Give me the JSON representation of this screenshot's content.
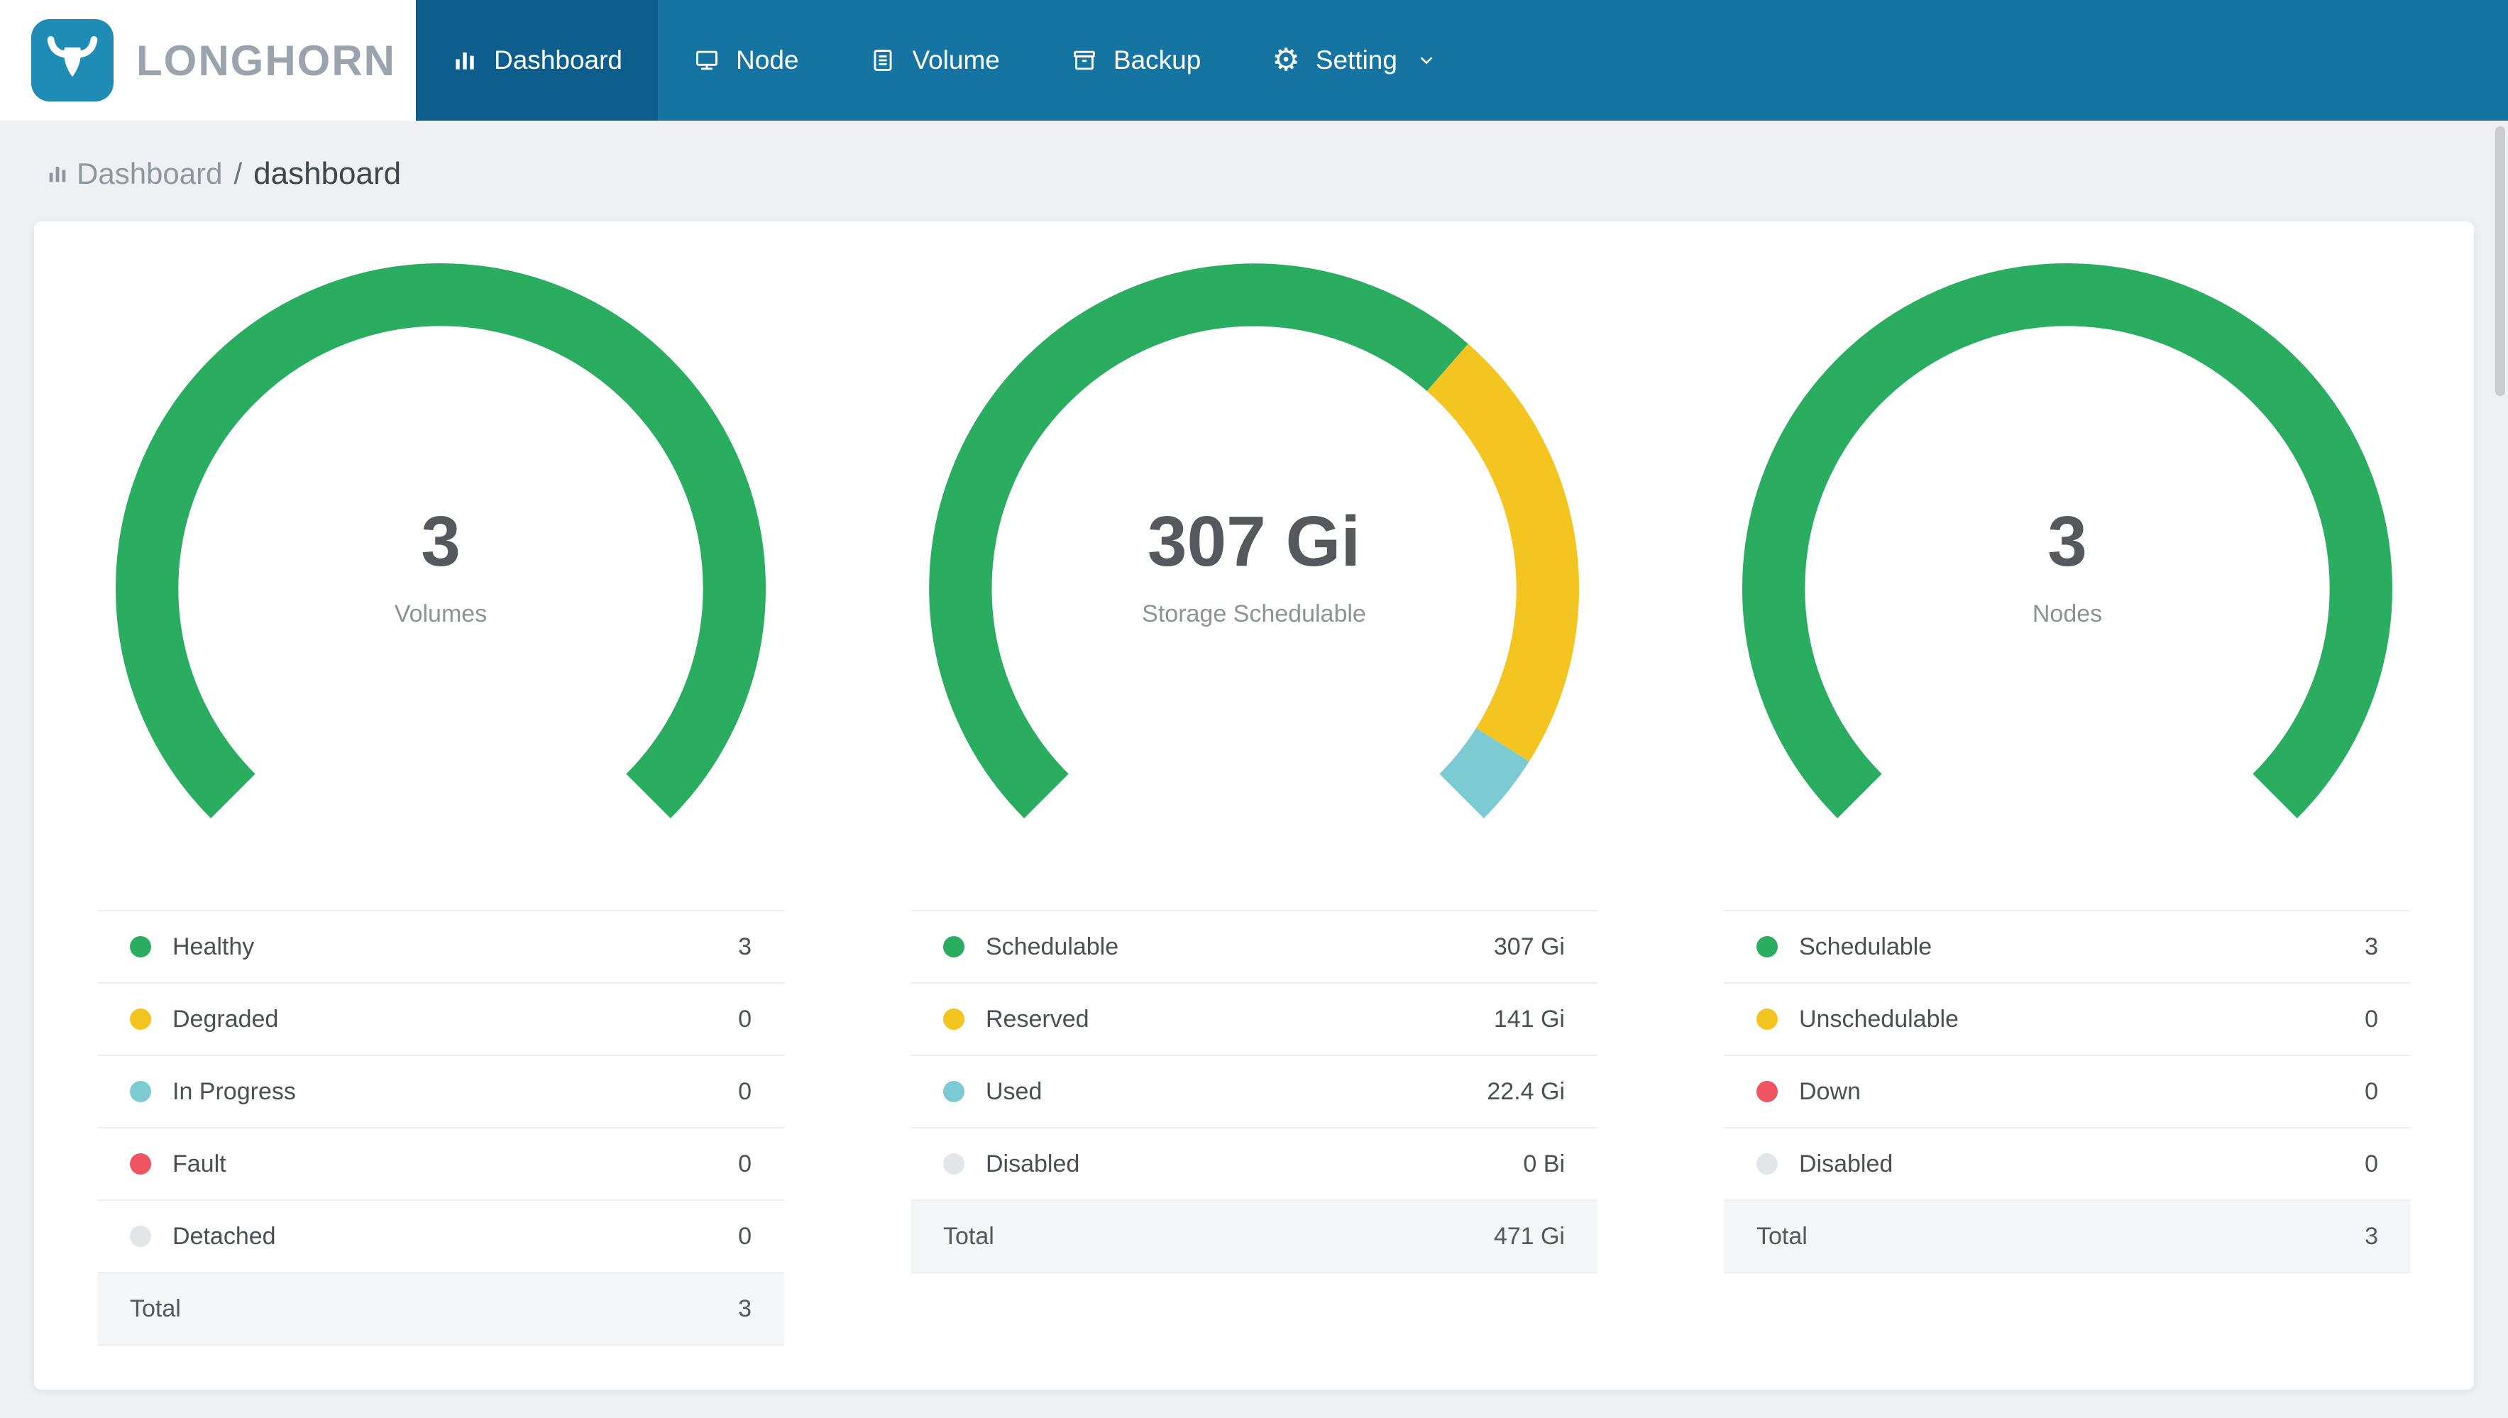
{
  "brand": {
    "name": "LONGHORN",
    "logo_color": "#1E8CB4"
  },
  "navbar": {
    "background": "#1674A2",
    "active_background": "#0D5E8C",
    "items": [
      {
        "label": "Dashboard",
        "icon": "dashboard-icon",
        "active": true
      },
      {
        "label": "Node",
        "icon": "node-icon",
        "active": false
      },
      {
        "label": "Volume",
        "icon": "volume-icon",
        "active": false
      },
      {
        "label": "Backup",
        "icon": "backup-icon",
        "active": false
      },
      {
        "label": "Setting",
        "icon": "setting-icon",
        "active": false,
        "has_dropdown": true
      }
    ]
  },
  "breadcrumb": {
    "section": "Dashboard",
    "separator": "/",
    "page": "dashboard"
  },
  "palette": {
    "green": "#2BAD61",
    "yellow": "#F4C420",
    "teal": "#7CCBD3",
    "red": "#EF5461",
    "gray": "#E3E6E9"
  },
  "chart_data": [
    {
      "type": "gauge",
      "center_value": "3",
      "center_label": "Volumes",
      "sweep_degrees": 270,
      "start_angle": 135,
      "segments": [
        {
          "label": "Healthy",
          "value": 3,
          "display": "3",
          "color": "green"
        },
        {
          "label": "Degraded",
          "value": 0,
          "display": "0",
          "color": "yellow"
        },
        {
          "label": "In Progress",
          "value": 0,
          "display": "0",
          "color": "teal"
        },
        {
          "label": "Fault",
          "value": 0,
          "display": "0",
          "color": "red"
        },
        {
          "label": "Detached",
          "value": 0,
          "display": "0",
          "color": "gray"
        }
      ],
      "total": {
        "label": "Total",
        "display": "3"
      }
    },
    {
      "type": "gauge",
      "center_value": "307 Gi",
      "center_label": "Storage Schedulable",
      "sweep_degrees": 270,
      "start_angle": 135,
      "segments": [
        {
          "label": "Schedulable",
          "value": 307,
          "display": "307 Gi",
          "color": "green"
        },
        {
          "label": "Reserved",
          "value": 141,
          "display": "141 Gi",
          "color": "yellow"
        },
        {
          "label": "Used",
          "value": 22.4,
          "display": "22.4 Gi",
          "color": "teal"
        },
        {
          "label": "Disabled",
          "value": 0,
          "display": "0 Bi",
          "color": "gray"
        }
      ],
      "total": {
        "label": "Total",
        "display": "471 Gi"
      }
    },
    {
      "type": "gauge",
      "center_value": "3",
      "center_label": "Nodes",
      "sweep_degrees": 270,
      "start_angle": 135,
      "segments": [
        {
          "label": "Schedulable",
          "value": 3,
          "display": "3",
          "color": "green"
        },
        {
          "label": "Unschedulable",
          "value": 0,
          "display": "0",
          "color": "yellow"
        },
        {
          "label": "Down",
          "value": 0,
          "display": "0",
          "color": "red"
        },
        {
          "label": "Disabled",
          "value": 0,
          "display": "0",
          "color": "gray"
        }
      ],
      "total": {
        "label": "Total",
        "display": "3"
      }
    }
  ]
}
